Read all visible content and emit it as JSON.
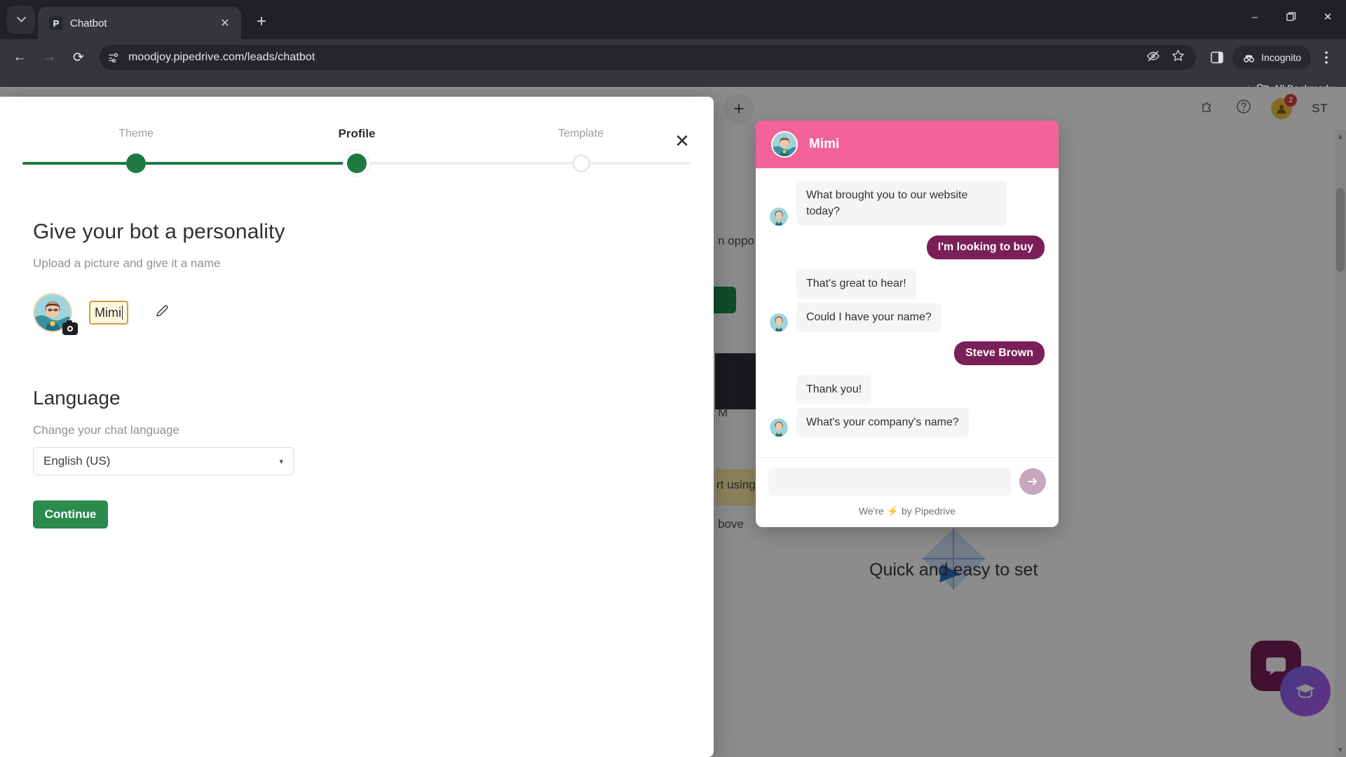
{
  "browser": {
    "tab": {
      "title": "Chatbot",
      "favicon_letter": "P",
      "close_icon": "close-icon"
    },
    "new_tab_label": "+",
    "tab_search_icon": "chevron-down-icon",
    "window": {
      "minimize": "–",
      "maximize": "❐",
      "close": "✕"
    },
    "nav": {
      "back": "←",
      "forward": "→",
      "reload": "⟳"
    },
    "omnibox": {
      "url": "moodjoy.pipedrive.com/leads/chatbot",
      "site_settings_icon": "page-info-icon",
      "tracking_protection_icon": "eye-slash-icon",
      "bookmark_icon": "star-icon"
    },
    "side_panel_icon": "side-panel-icon",
    "incognito_label": "Incognito",
    "menu_icon": "kebab-menu-icon",
    "bookmarks": {
      "separator": "|",
      "all_bookmarks_label": "All Bookmarks",
      "folder_icon": "folder-icon"
    }
  },
  "modal": {
    "close_label": "✕",
    "stepper": {
      "steps": [
        {
          "label": "Theme",
          "state": "done",
          "pos": 17
        },
        {
          "label": "Profile",
          "state": "current",
          "pos": 50
        },
        {
          "label": "Template",
          "state": "todo",
          "pos": 83.5
        }
      ],
      "fill_percent": 50
    },
    "personality": {
      "title": "Give your bot a personality",
      "subtitle": "Upload a picture and give it a name",
      "bot_name": "Mimi",
      "avatar_alt": "bot-avatar",
      "camera_icon": "camera-icon",
      "edit_icon": "pencil-icon"
    },
    "language": {
      "title": "Language",
      "label": "Change your chat language",
      "selected": "English (US)",
      "chevron": "▾"
    },
    "continue_label": "Continue"
  },
  "chat_preview": {
    "header_name": "Mimi",
    "header_color": "#f4629a",
    "user_bubble_color": "#7a1f57",
    "messages": [
      {
        "side": "in",
        "text": "What brought you to our website today?",
        "avatar": true
      },
      {
        "side": "out",
        "text": "I'm looking to buy"
      },
      {
        "side": "in",
        "text": "That's great to hear!",
        "avatar": false
      },
      {
        "side": "in",
        "text": "Could I have your name?",
        "avatar": true
      },
      {
        "side": "out",
        "text": "Steve Brown"
      },
      {
        "side": "in",
        "text": "Thank you!",
        "avatar": false
      },
      {
        "side": "in",
        "text": "What's your company's name?",
        "avatar": true
      }
    ],
    "input_placeholder": "",
    "send_icon": "send-arrow-icon",
    "footer_prefix": "We're",
    "footer_bolt": "⚡",
    "footer_suffix": "by Pipedrive"
  },
  "underlying_page": {
    "add_icon": "+",
    "puzzle_icon": "puzzle-icon",
    "help_icon": "help-icon",
    "notification_count": "2",
    "user_initials": "ST",
    "fragment_opportunity": "n oppo",
    "fragment_am": "M",
    "fragment_using": "rt using C",
    "fragment_above": "bove",
    "tagline": "Quick and easy to set"
  }
}
